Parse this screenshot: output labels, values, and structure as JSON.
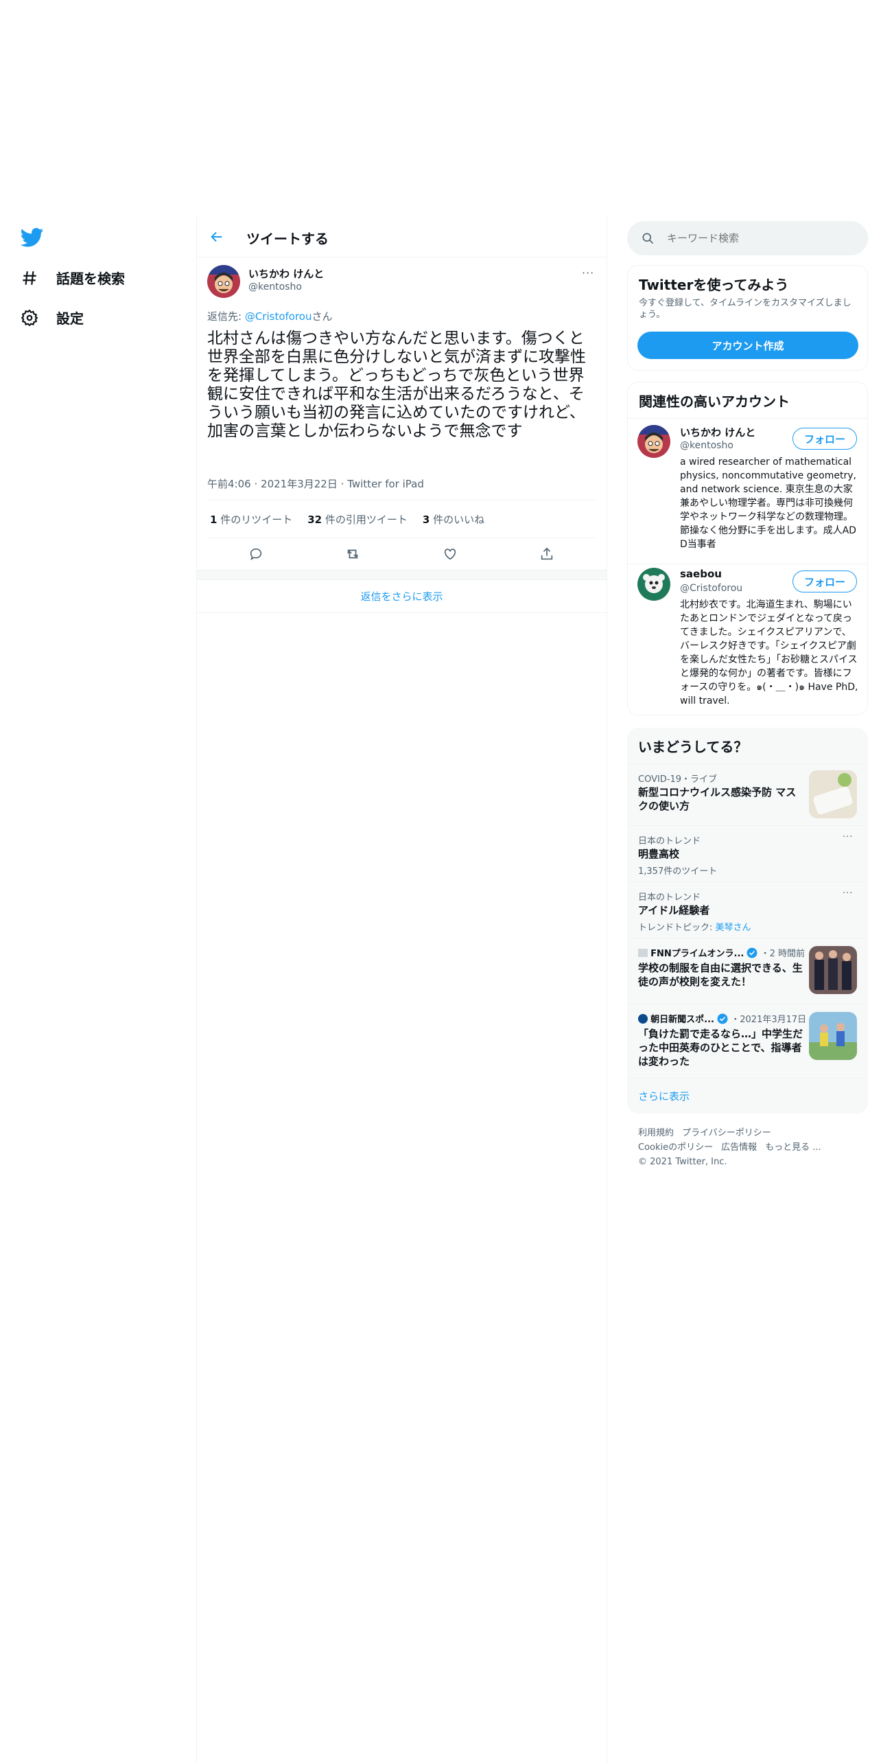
{
  "nav": {
    "items": [
      {
        "label": "話題を検索",
        "icon": "hashtag-icon"
      },
      {
        "label": "設定",
        "icon": "gear-icon"
      }
    ]
  },
  "header": {
    "title": "ツイートする"
  },
  "tweet": {
    "author_name": "いちかわ けんと",
    "author_handle": "@kentosho",
    "more": "···",
    "reply_prefix": "返信先: ",
    "reply_to": "@Cristoforou",
    "reply_suffix": "さん",
    "text": "北村さんは傷つきやい方なんだと思います。傷つくと世界全部を白黒に色分けしないと気が済まずに攻撃性を発揮してしまう。どっちもどっちで灰色という世界観に安住できれば平和な生活が出来るだろうなと、そういう願いも当初の発言に込めていたのですけれど、加害の言葉としか伝わらないようで無念です",
    "time": "午前4:06",
    "date": "2021年3月22日",
    "source": "Twitter for iPad",
    "dot": "·",
    "retweets_count": "1",
    "retweets_label": " 件のリツイート",
    "quotes_count": "32",
    "quotes_label": " 件の引用ツイート",
    "likes_count": "3",
    "likes_label": " 件のいいね"
  },
  "show_more_replies": "返信をさらに表示",
  "search": {
    "placeholder": "キーワード検索"
  },
  "signup": {
    "title": "Twitterを使ってみよう",
    "subtitle": "今すぐ登録して、タイムラインをカスタマイズしましょう。",
    "button": "アカウント作成"
  },
  "relevant": {
    "title": "関連性の高いアカウント",
    "follow_label": "フォロー",
    "accounts": [
      {
        "name": "いちかわ けんと",
        "handle": "@kentosho",
        "bio": "a wired researcher of mathematical physics, noncommutative geometry, and network science. 東京生息の大家兼あやしい物理学者。専門は非可換幾何学やネットワーク科学などの数理物理。節操なく他分野に手を出します。成人ADD当事者"
      },
      {
        "name": "saebou",
        "handle": "@Cristoforou",
        "bio": "北村紗衣です。北海道生まれ、駒場にいたあとロンドンでジェダイとなって戻ってきました。シェイクスピアリアンで、バーレスク好きです。「シェイクスピア劇を楽しんだ女性たち」「お砂糖とスパイスと爆発的な何か」の著者です。皆様にフォースの守りを。๑(・＿・)๑ Have PhD, will travel."
      }
    ]
  },
  "trends": {
    "title": "いまどうしてる？",
    "items": [
      {
        "category": "COVID-19・ライブ",
        "title": "新型コロナウイルス感染予防 マスクの使い方"
      },
      {
        "category": "日本のトレンド",
        "title": "明豊高校",
        "sub": "1,357件のツイート"
      },
      {
        "category": "日本のトレンド",
        "title": "アイドル経験者",
        "sub_prefix": "トレンドトピック: ",
        "sub_link": "美琴さん"
      },
      {
        "source": "FNNプライムオンラ...",
        "time": "・2 時間前",
        "title": "学校の制服を自由に選択できる、生徒の声が校則を変えた！"
      },
      {
        "source": "朝日新聞スポ...",
        "time": "・2021年3月17日",
        "title": "「負けた罰で走るなら…」中学生だった中田英寿のひとことで、指導者は変わった"
      }
    ],
    "show_more": "さらに表示"
  },
  "footer": {
    "links_row1": [
      "利用規約",
      "プライバシーポリシー"
    ],
    "links_row2": [
      "Cookieのポリシー",
      "広告情報",
      "もっと見る ..."
    ],
    "copyright": "© 2021 Twitter, Inc."
  },
  "colors": {
    "accent": "#1d9bf0",
    "text": "#0f1419",
    "secondary": "#536471",
    "border": "#eff3f4"
  }
}
